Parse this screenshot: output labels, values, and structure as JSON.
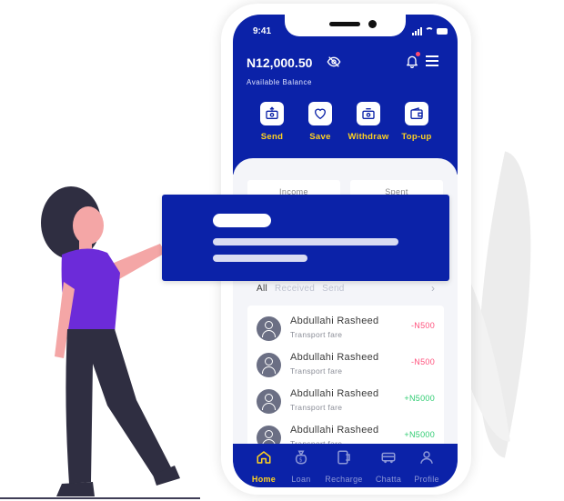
{
  "status_bar": {
    "time": "9:41"
  },
  "wallet": {
    "balance": "N12,000.50",
    "balance_label": "Available Balance"
  },
  "actions": [
    {
      "label": "Send",
      "icon": "send-icon"
    },
    {
      "label": "Save",
      "icon": "heart-icon"
    },
    {
      "label": "Withdraw",
      "icon": "withdraw-icon"
    },
    {
      "label": "Top-up",
      "icon": "wallet-icon"
    }
  ],
  "summary": {
    "income_label": "Income",
    "spent_label": "Spent"
  },
  "filters": {
    "all": "All",
    "received": "Received",
    "send": "Send"
  },
  "transactions": [
    {
      "name": "Abdullahi Rasheed",
      "note": "Transport fare",
      "amount": "-N500",
      "type": "debit"
    },
    {
      "name": "Abdullahi Rasheed",
      "note": "Transport fare",
      "amount": "-N500",
      "type": "debit"
    },
    {
      "name": "Abdullahi Rasheed",
      "note": "Transport fare",
      "amount": "+N5000",
      "type": "credit"
    },
    {
      "name": "Abdullahi Rasheed",
      "note": "Transport fare",
      "amount": "+N5000",
      "type": "credit"
    }
  ],
  "nav": [
    {
      "label": "Home",
      "icon": "home-icon",
      "active": true
    },
    {
      "label": "Loan",
      "icon": "money-bag-icon",
      "active": false
    },
    {
      "label": "Recharge",
      "icon": "recharge-icon",
      "active": false
    },
    {
      "label": "Chatta",
      "icon": "bus-icon",
      "active": false
    },
    {
      "label": "Profile",
      "icon": "profile-icon",
      "active": false
    }
  ],
  "colors": {
    "primary": "#0b22a8",
    "accent": "#ffd21f",
    "debit": "#ff4f7b",
    "credit": "#2ecc71",
    "skin": "#f4a6a6",
    "shirt": "#6c2bd9",
    "hair": "#2f2e41"
  }
}
